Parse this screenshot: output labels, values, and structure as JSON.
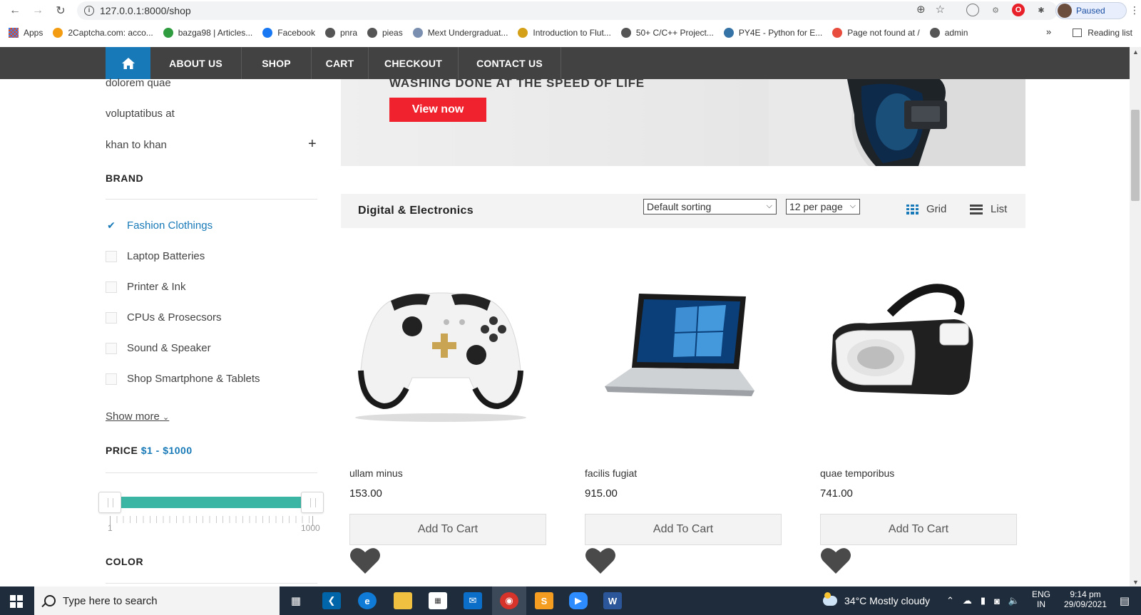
{
  "browser": {
    "url": "127.0.0.1:8000/shop",
    "profile_label": "Paused",
    "bookmarks": [
      {
        "label": "Apps",
        "icon": "apps-grid-icon",
        "color": "#e64a19"
      },
      {
        "label": "2Captcha.com: acco...",
        "icon": "2captcha-icon",
        "color": "#f39c12"
      },
      {
        "label": "bazga98 | Articles...",
        "icon": "bazga-icon",
        "color": "#2e9c3f"
      },
      {
        "label": "Facebook",
        "icon": "facebook-icon",
        "color": "#1877f2"
      },
      {
        "label": "pnra",
        "icon": "globe-icon",
        "color": "#555555"
      },
      {
        "label": "pieas",
        "icon": "globe-icon",
        "color": "#555555"
      },
      {
        "label": "Mext Undergraduat...",
        "icon": "mext-icon",
        "color": "#7a8fb0"
      },
      {
        "label": "Introduction to Flut...",
        "icon": "flutter-icon",
        "color": "#d4a017"
      },
      {
        "label": "50+ C/C++ Project...",
        "icon": "globe-icon",
        "color": "#555555"
      },
      {
        "label": "PY4E - Python for E...",
        "icon": "python-icon",
        "color": "#3572a5"
      },
      {
        "label": "Page not found at /",
        "icon": "django-icon",
        "color": "#e74c3c"
      },
      {
        "label": "admin",
        "icon": "globe-icon",
        "color": "#555555"
      }
    ],
    "reading_list": "Reading list"
  },
  "nav": {
    "items": [
      "ABOUT US",
      "SHOP",
      "CART",
      "CHECKOUT",
      "CONTACT US"
    ]
  },
  "sidebar": {
    "categories": [
      "dolorem quae",
      "voluptatibus at",
      "khan to khan"
    ],
    "brand_heading": "BRAND",
    "brands": [
      {
        "label": "Fashion Clothings",
        "checked": true
      },
      {
        "label": "Laptop Batteries",
        "checked": false
      },
      {
        "label": "Printer & Ink",
        "checked": false
      },
      {
        "label": "CPUs & Prosecsors",
        "checked": false
      },
      {
        "label": "Sound & Speaker",
        "checked": false
      },
      {
        "label": "Shop Smartphone & Tablets",
        "checked": false
      }
    ],
    "show_more": "Show more",
    "price_heading": "PRICE",
    "price_range": "$1 - $1000",
    "slider": {
      "min_label": "1",
      "max_label": "1000",
      "low": 1,
      "high": 1000
    },
    "color_heading": "COLOR"
  },
  "banner": {
    "title": "WASHING DONE AT THE SPEED OF LIFE",
    "cta": "View now"
  },
  "toolbar": {
    "title": "Digital & Electronics",
    "sort": "Default sorting",
    "per_page": "12 per page",
    "grid_label": "Grid",
    "list_label": "List"
  },
  "products": [
    {
      "name": "ullam minus",
      "price": "153.00",
      "cart": "Add To Cart",
      "image": "game-controller"
    },
    {
      "name": "facilis fugiat",
      "price": "915.00",
      "cart": "Add To Cart",
      "image": "laptop"
    },
    {
      "name": "quae temporibus",
      "price": "741.00",
      "cart": "Add To Cart",
      "image": "vr-headset"
    }
  ],
  "taskbar": {
    "search_placeholder": "Type here to search",
    "weather": "34°C  Mostly cloudy",
    "lang_top": "ENG",
    "lang_bottom": "IN",
    "time": "9:14 pm",
    "date": "29/09/2021"
  },
  "colors": {
    "nav_bg": "#424242",
    "accent": "#1779b7",
    "cta_red": "#f0222d",
    "slider_teal": "#3bb5a4"
  }
}
